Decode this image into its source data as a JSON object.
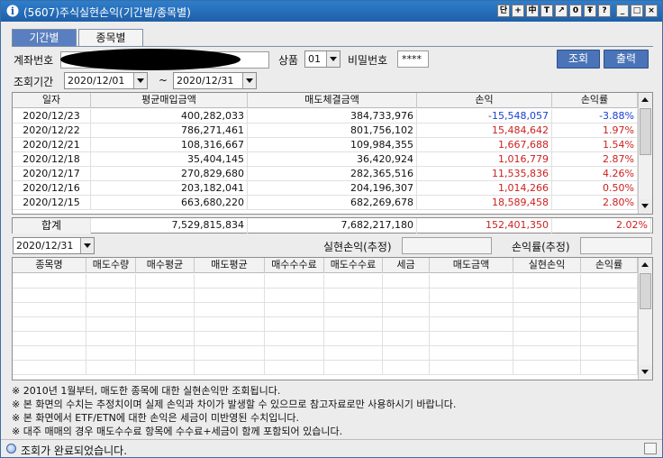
{
  "window": {
    "title": "(5607)주식실현손익(기간별/종목별)",
    "buttons": [
      "단",
      "+",
      "中",
      "T",
      "↗",
      "0",
      "Ŧ",
      "?",
      "_",
      "□",
      "×"
    ]
  },
  "tabs": [
    {
      "label": "기간별",
      "active": true
    },
    {
      "label": "종목별",
      "active": false
    }
  ],
  "form": {
    "account_label": "계좌번호",
    "product_label": "상품",
    "product_value": "01",
    "password_label": "비밀번호",
    "password_value": "****",
    "query_button": "조회",
    "print_button": "출력",
    "period_label": "조회기간",
    "date_from": "2020/12/01",
    "date_sep": "~",
    "date_to": "2020/12/31"
  },
  "period_table": {
    "headers": [
      "일자",
      "평균매입금액",
      "매도체결금액",
      "손익",
      "손익률"
    ],
    "rows": [
      [
        "2020/12/23",
        "400,282,033",
        "384,733,976",
        "-15,548,057",
        "-3.88%"
      ],
      [
        "2020/12/22",
        "786,271,461",
        "801,756,102",
        "15,484,642",
        "1.97%"
      ],
      [
        "2020/12/21",
        "108,316,667",
        "109,984,355",
        "1,667,688",
        "1.54%"
      ],
      [
        "2020/12/18",
        "35,404,145",
        "36,420,924",
        "1,016,779",
        "2.87%"
      ],
      [
        "2020/12/17",
        "270,829,680",
        "282,365,516",
        "11,535,836",
        "4.26%"
      ],
      [
        "2020/12/16",
        "203,182,041",
        "204,196,307",
        "1,014,266",
        "0.50%"
      ],
      [
        "2020/12/15",
        "663,680,220",
        "682,269,678",
        "18,589,458",
        "2.80%"
      ]
    ],
    "total": [
      "합계",
      "7,529,815,834",
      "7,682,217,180",
      "152,401,350",
      "2.02%"
    ]
  },
  "detail": {
    "date": "2020/12/31",
    "realized_label": "실현손익(추정)",
    "realized_value": "",
    "rate_label": "손익률(추정)",
    "rate_value": "",
    "headers": [
      "종목명",
      "매도수량",
      "매수평균",
      "매도평균",
      "매수수수료",
      "매도수수료",
      "세금",
      "매도금액",
      "실현손익",
      "손익률"
    ]
  },
  "notes": [
    "※ 2010년 1월부터, 매도한 종목에 대한 실현손익만 조회됩니다.",
    "※ 본 화면의 수치는 추정치이며 실제 손익과 차이가 발생할 수 있으므로 참고자료로만 사용하시기 바랍니다.",
    "※ 본 화면에서 ETF/ETN에 대한 손익은 세금이 미반영된 수치입니다.",
    "※ 대주 매매의 경우 매도수수료 항목에 수수료+세금이 함께 포함되어 있습니다."
  ],
  "status": {
    "text": "조회가 완료되었습니다."
  },
  "colors": {
    "gain": "#cc1f1f",
    "loss": "#1a3fd0",
    "accent": "#4a74b7"
  }
}
